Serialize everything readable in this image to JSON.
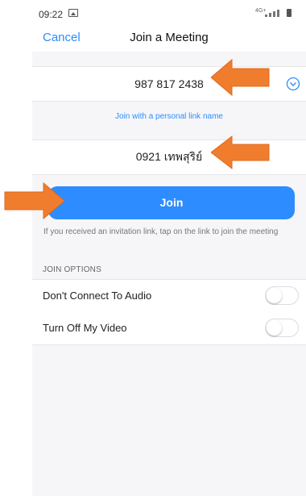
{
  "status_bar": {
    "time": "09:22",
    "network": "4G+"
  },
  "nav": {
    "cancel_label": "Cancel",
    "title": "Join a Meeting"
  },
  "meeting_id": {
    "value": "987 817 2438"
  },
  "personal_link_label": "Join with a personal link name",
  "screen_name": {
    "value": "0921 เทพสุริย์"
  },
  "join_button_label": "Join",
  "hint_text": "If you received an invitation link, tap on the link to join the meeting",
  "join_options": {
    "header": "JOIN OPTIONS",
    "items": [
      {
        "label": "Don't Connect To Audio",
        "enabled": false
      },
      {
        "label": "Turn Off My Video",
        "enabled": false
      }
    ]
  },
  "colors": {
    "accent": "#2d8cff",
    "arrow": "#f07d2e",
    "background": "#f6f6f8"
  },
  "icons": [
    "image-icon",
    "signal-icon",
    "battery-icon",
    "chevron-down-circle-icon",
    "arrow-icon"
  ]
}
